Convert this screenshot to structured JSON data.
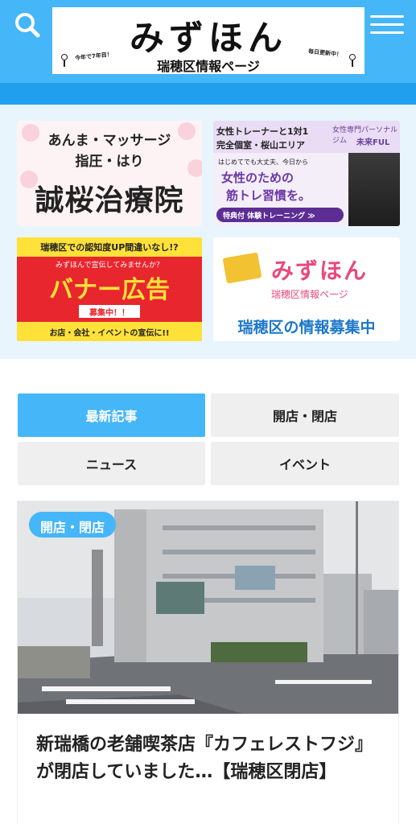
{
  "header": {
    "logo_title": "みずほん",
    "logo_subtitle": "瑞穂区情報ページ",
    "logo_note_left": "今年で7年目！",
    "logo_note_right": "毎日更新中！",
    "search_icon": "search-icon",
    "menu_icon": "hamburger-menu-icon",
    "brand_color": "#45b6f7"
  },
  "banners": [
    {
      "line1": "あんま・マッサージ",
      "line2": "指圧・はり",
      "line3": "誠桜治療院"
    },
    {
      "line1": "女性トレーナーと1対1",
      "line2": "完全個室・桜山エリア",
      "brand_top": "女性専門パーソナルジム",
      "brand_name": "未来FUL",
      "line3": "はじめてでも大丈夫、今日から",
      "line4": "女性のための",
      "line5": "筋トレ習慣を。",
      "button": "特典付 体験トレーニング ≫"
    },
    {
      "top": "瑞穂区での認知度UP間違いなし!?",
      "sub": "みずほんで宣伝してみませんか？",
      "main": "バナー広告",
      "badge": "募集中！！",
      "bottom": "お店・会社・イベントの宣伝に!!"
    },
    {
      "title": "みずほん",
      "subtitle": "瑞穂区情報ページ",
      "bottom": "瑞穂区の情報募集中"
    }
  ],
  "tabs": [
    {
      "label": "最新記事",
      "active": true
    },
    {
      "label": "開店・閉店",
      "active": false
    },
    {
      "label": "ニュース",
      "active": false
    },
    {
      "label": "イベント",
      "active": false
    }
  ],
  "article": {
    "category": "開店・閉店",
    "title": "新瑞橋の老舗喫茶店『カフェレストフジ』が閉店していました…【瑞穂区閉店】"
  }
}
